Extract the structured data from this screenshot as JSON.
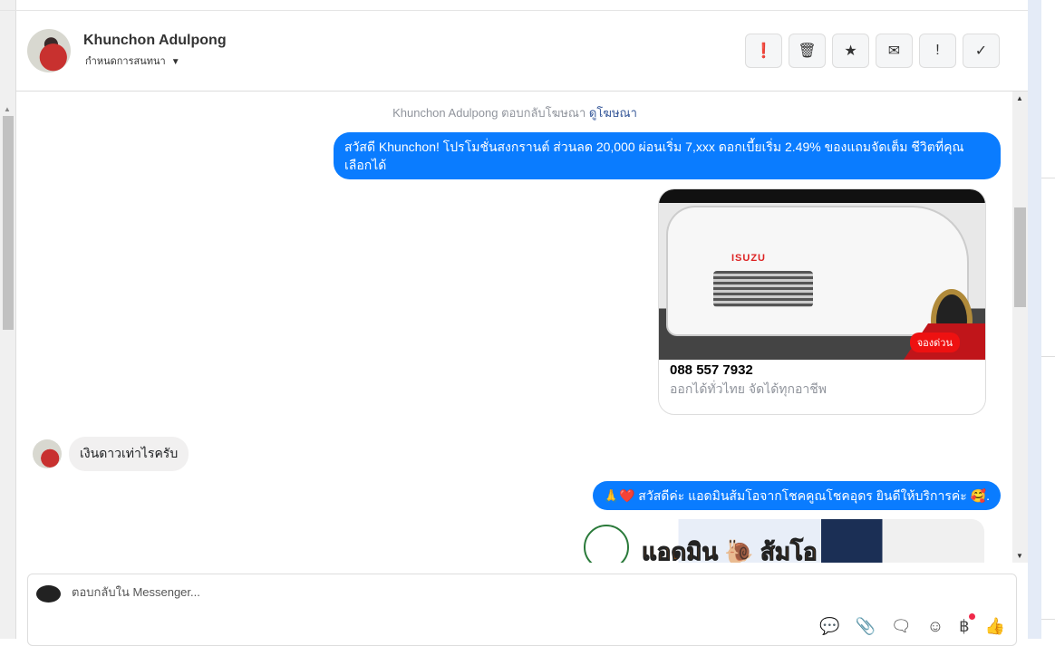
{
  "header": {
    "name": "Khunchon Adulpong",
    "subtitle": "กำหนดการสนทนา",
    "actions": [
      {
        "icon": "alert-circle-icon",
        "glyph": "❗"
      },
      {
        "icon": "trash-icon",
        "glyph": "🗑"
      },
      {
        "icon": "star-icon",
        "glyph": "★"
      },
      {
        "icon": "envelope-icon",
        "glyph": "✉"
      },
      {
        "icon": "exclamation-icon",
        "glyph": "!"
      },
      {
        "icon": "check-icon",
        "glyph": "✓"
      }
    ]
  },
  "chat": {
    "system_text": "Khunchon Adulpong ตอบกลับโฆษณา",
    "system_link": "ดูโฆษณา",
    "msg1": "สวัสดี Khunchon! โปรโมชั่นสงกรานต์ ส่วนลด 20,000 ผ่อนเริ่ม 7,xxx ดอกเบี้ยเริ่ม 2.49% ของแถมจัดเต็ม ชีวิตที่คุณเลือกได้",
    "card": {
      "image_logo": "ISUZU",
      "image_badge": "จองด่วน",
      "title": "088 557 7932",
      "subtitle": "ออกได้ทั่วไทย จัดได้ทุกอาชีพ"
    },
    "incoming": "เงินดาวเท่าไรครับ",
    "msg2": "🙏❤️ สวัสดีค่ะ แอดมินส้มโอจากโชคคูณโชคอุดร ยินดีให้บริการค่ะ 🥰.",
    "banner_text": "แอดมิน 🐌 ส้มโอ"
  },
  "composer": {
    "placeholder": "ตอบกลับใน Messenger...",
    "tools": [
      {
        "icon": "saved-reply-icon",
        "glyph": "💬"
      },
      {
        "icon": "paperclip-icon",
        "glyph": "📎"
      },
      {
        "icon": "chat-bubble-icon",
        "glyph": "🗨"
      },
      {
        "icon": "emoji-icon",
        "glyph": "☺"
      },
      {
        "icon": "baht-icon",
        "glyph": "฿"
      },
      {
        "icon": "thumbs-up-icon",
        "glyph": "👍"
      }
    ]
  },
  "colors": {
    "accent": "#0a7cff",
    "notification": "#f02849"
  }
}
